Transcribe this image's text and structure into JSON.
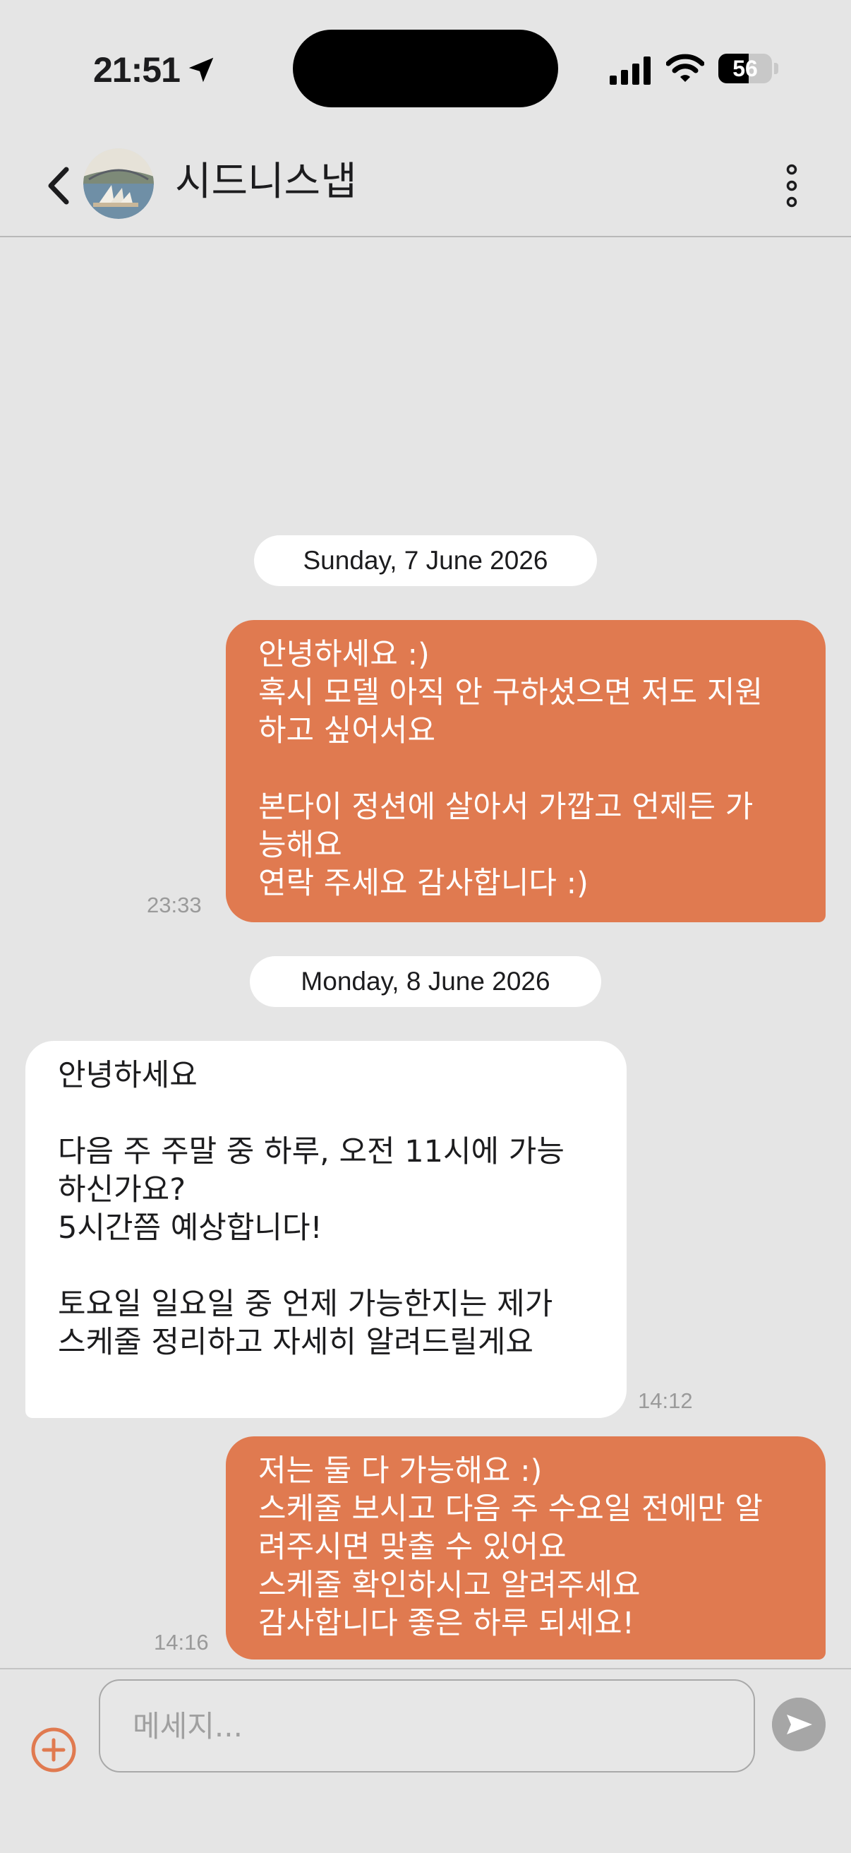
{
  "status_bar": {
    "time": "21:51",
    "battery": "56",
    "battery_level": 0.56,
    "icons": [
      "location-arrow-icon",
      "signal-icon",
      "wifi-icon",
      "battery-icon"
    ]
  },
  "header": {
    "title": "시드니스냅",
    "back_icon": "chevron-left-icon",
    "more_icon": "vertical-ellipsis-icon",
    "avatar": "sydney-opera-house-photo"
  },
  "conversation": {
    "date_1": "Sunday, 7 June 2026",
    "date_2": "Monday, 8 June 2026",
    "messages": [
      {
        "direction": "outgoing",
        "text": "안녕하세요 :)\n혹시 모델 아직 안 구하셨으면 저도 지원\n하고 싶어서요\n\n본다이 정션에 살아서 가깝고 언제든 가\n능해요\n연락 주세요 감사합니다 :)",
        "time": "23:33"
      },
      {
        "direction": "incoming",
        "text": "안녕하세요\n\n다음 주 주말 중 하루, 오전 11시에 가능\n하신가요?\n5시간쯤 예상합니다!\n\n토요일 일요일 중 언제 가능한지는 제가\n스케줄 정리하고 자세히 알려드릴게요",
        "time": "14:12"
      },
      {
        "direction": "outgoing",
        "text": "저는 둘 다 가능해요 :)\n스케줄 보시고 다음 주 수요일 전에만 알\n려주시면 맞출 수 있어요\n스케줄 확인하시고 알려주세요\n감사합니다 좋은 하루 되세요!",
        "time": "14:16"
      }
    ]
  },
  "composer": {
    "placeholder": "메세지...",
    "value": "",
    "add_icon": "plus-circle-icon",
    "send_icon": "send-arrow-icon"
  },
  "colors": {
    "accent": "#E07A50",
    "background": "#E5E5E5",
    "incoming_bubble": "#FFFFFF",
    "timestamp": "#9A9A9A",
    "send_button": "#A6A6A6"
  }
}
